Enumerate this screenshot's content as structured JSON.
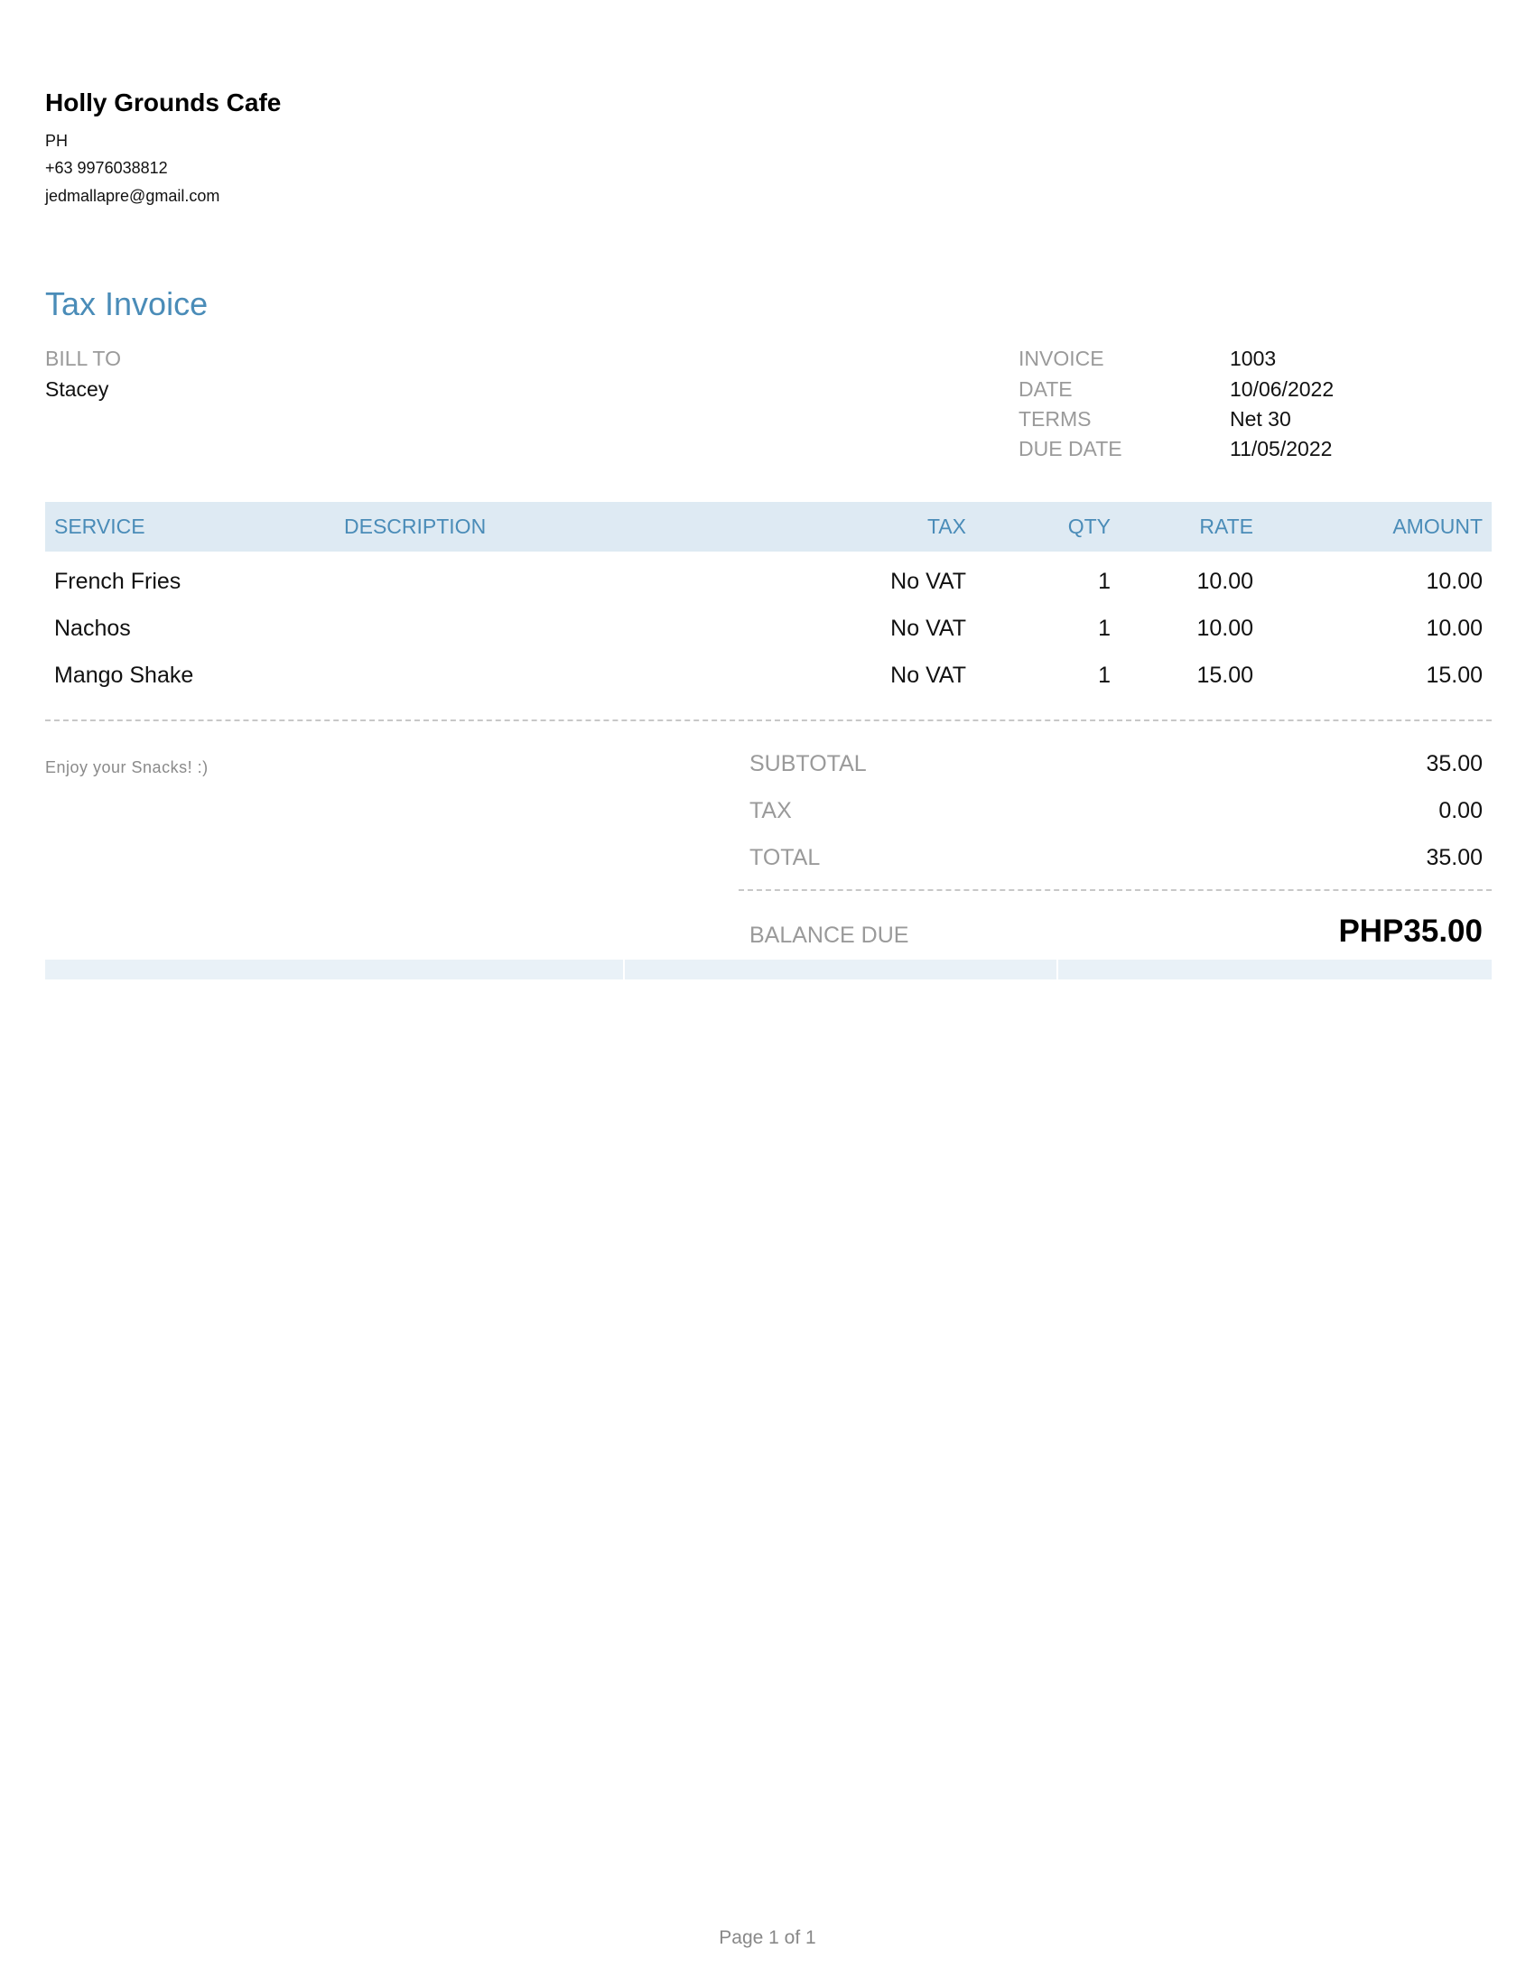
{
  "company": {
    "name": "Holly Grounds Cafe",
    "country": "PH",
    "phone": "+63 9976038812",
    "email": "jedmallapre@gmail.com"
  },
  "title": "Tax Invoice",
  "bill_to": {
    "label": "BILL TO",
    "name": "Stacey"
  },
  "meta": [
    {
      "label": "INVOICE",
      "value": "1003"
    },
    {
      "label": "DATE",
      "value": "10/06/2022"
    },
    {
      "label": "TERMS",
      "value": "Net 30"
    },
    {
      "label": "DUE DATE",
      "value": "11/05/2022"
    }
  ],
  "table": {
    "headers": {
      "service": "SERVICE",
      "description": "DESCRIPTION",
      "tax": "TAX",
      "qty": "QTY",
      "rate": "RATE",
      "amount": "AMOUNT"
    },
    "rows": [
      {
        "service": "French Fries",
        "description": "",
        "tax": "No VAT",
        "qty": "1",
        "rate": "10.00",
        "amount": "10.00"
      },
      {
        "service": "Nachos",
        "description": "",
        "tax": "No VAT",
        "qty": "1",
        "rate": "10.00",
        "amount": "10.00"
      },
      {
        "service": "Mango Shake",
        "description": "",
        "tax": "No VAT",
        "qty": "1",
        "rate": "15.00",
        "amount": "15.00"
      }
    ]
  },
  "note": "Enjoy your Snacks! :)",
  "summary": {
    "subtotal_label": "SUBTOTAL",
    "subtotal": "35.00",
    "tax_label": "TAX",
    "tax": "0.00",
    "total_label": "TOTAL",
    "total": "35.00",
    "balance_label": "BALANCE DUE",
    "balance": "PHP35.00"
  },
  "page": "Page 1 of 1"
}
